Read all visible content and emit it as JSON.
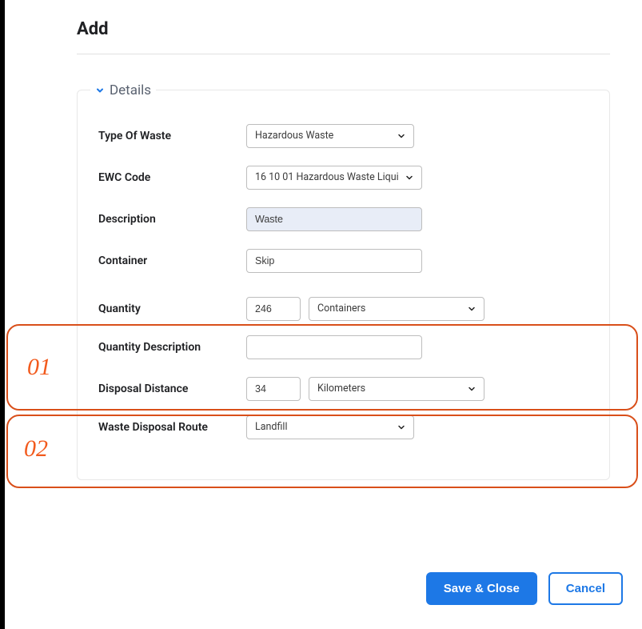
{
  "page": {
    "title": "Add"
  },
  "panel": {
    "title": "Details"
  },
  "annotations": {
    "label1": "01",
    "label2": "02"
  },
  "form": {
    "type_of_waste": {
      "label": "Type Of Waste",
      "value": "Hazardous Waste"
    },
    "ewc_code": {
      "label": "EWC Code",
      "value": "16 10 01 Hazardous Waste Liqui"
    },
    "description": {
      "label": "Description",
      "value": "Waste"
    },
    "container": {
      "label": "Container",
      "value": "Skip"
    },
    "quantity": {
      "label": "Quantity",
      "value": "246",
      "unit": "Containers"
    },
    "quantity_desc": {
      "label": "Quantity Description",
      "value": ""
    },
    "disposal_distance": {
      "label": "Disposal Distance",
      "value": "34",
      "unit": "Kilometers"
    },
    "disposal_route": {
      "label": "Waste Disposal Route",
      "value": "Landfill"
    }
  },
  "actions": {
    "save": "Save & Close",
    "cancel": "Cancel"
  }
}
